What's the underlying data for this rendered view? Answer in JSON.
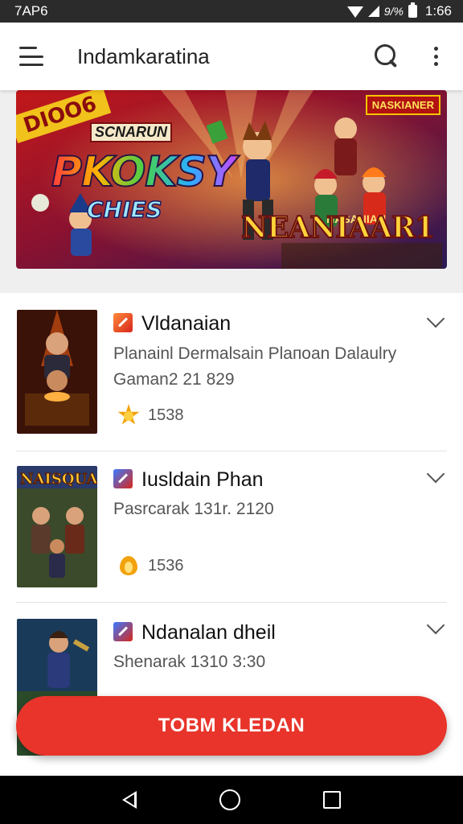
{
  "status_bar": {
    "time_left": "7AP6",
    "battery_text": "9/%",
    "time_right": "1:66"
  },
  "app_bar": {
    "title": "Indamkaratina"
  },
  "banner": {
    "ribbon": "DIOO6",
    "top_right": "NASKIANER",
    "subtitle": "SCNARUN",
    "logo": "PKOKSY",
    "logo_sub": "CHIES",
    "small_label": "NASANIAN",
    "title_right": "NEANIAAR1"
  },
  "games": [
    {
      "title": "Vldanaian",
      "desc": "Planainl Dermalsain Plaпoan Dalaulry Gaman2 21 829",
      "rating": "1538",
      "thumb_label": "",
      "rating_icon": "sun-icon"
    },
    {
      "title": "Iusldain Phan",
      "desc": "Pasrcarak 131r. 2120",
      "rating": "1536",
      "thumb_label": "NAISQUAK",
      "rating_icon": "flame-icon"
    },
    {
      "title": "Ndanalan dheil",
      "desc": "Shenarak 1310 3:30",
      "rating": "",
      "thumb_label": "",
      "rating_icon": ""
    }
  ],
  "fab": {
    "label": "TOBM KLEDAN"
  },
  "colors": {
    "accent": "#e8342a",
    "status_bar": "#2b2b2b",
    "nav_bar": "#000000"
  }
}
